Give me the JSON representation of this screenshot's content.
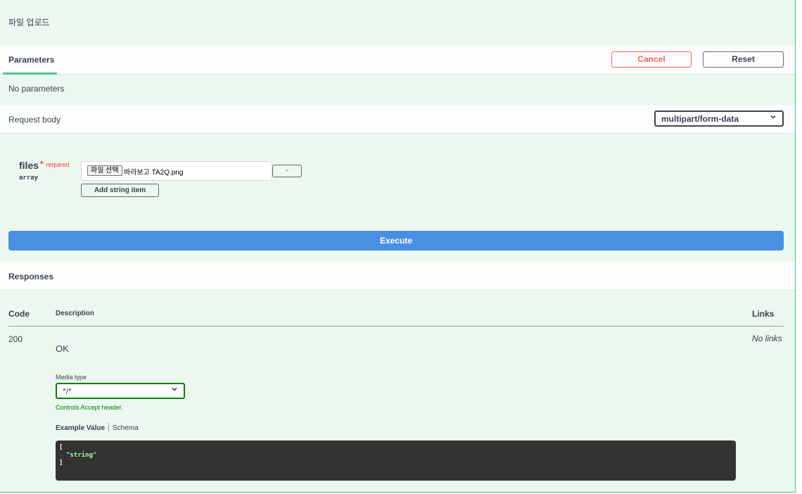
{
  "summary": {
    "description": "파일 업로드"
  },
  "parameters": {
    "tab_label": "Parameters",
    "cancel_label": "Cancel",
    "reset_label": "Reset",
    "empty_text": "No parameters"
  },
  "request_body": {
    "label": "Request body",
    "content_type": "multipart/form-data",
    "param": {
      "name": "files",
      "required_mark": "*",
      "required_text": "required",
      "type": "array",
      "file_button": "파일 선택",
      "file_name": "바라보고 TA2Q.png",
      "remove_label": "-",
      "add_item_label": "Add string item"
    }
  },
  "execute_label": "Execute",
  "responses": {
    "title": "Responses",
    "headers": {
      "code": "Code",
      "description": "Description",
      "links": "Links"
    },
    "rows": [
      {
        "code": "200",
        "description": "OK",
        "links": "No links",
        "media_type_label": "Media type",
        "media_type": "*/*",
        "controls_text": "Controls Accept header.",
        "example_tab": "Example Value",
        "schema_tab": "Schema",
        "example_line1": "[",
        "example_line2": "\"string\"",
        "example_line3": "]"
      }
    ]
  },
  "colors": {
    "accent": "#49cc90",
    "execute": "#4990e2",
    "cancel": "#ff6060",
    "code_bg": "#333333"
  }
}
